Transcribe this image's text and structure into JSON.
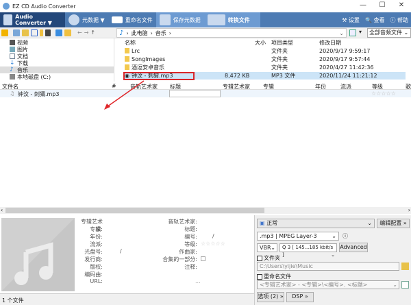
{
  "window": {
    "title": "EZ CD Audio Converter",
    "min": "—",
    "max": "☐",
    "close": "✕"
  },
  "ribbon": {
    "audio_converter": "Audio Converter ▼",
    "metadata": "元数据 ▼",
    "rename": "重命名文件",
    "save_meta": "保存元数据",
    "convert": "转换文件",
    "settings": "设置",
    "view": "查看",
    "help": "帮助"
  },
  "address": {
    "crumbs": [
      "此电脑",
      "音乐"
    ],
    "filter": "全部音频文件 ⌄"
  },
  "tree": [
    {
      "label": "视频"
    },
    {
      "label": "图片"
    },
    {
      "label": "文档"
    },
    {
      "label": "下载"
    },
    {
      "label": "音乐"
    },
    {
      "label": "本地磁盘 (C:)"
    }
  ],
  "files": {
    "headers": {
      "name": "名称",
      "size": "大小",
      "type": "项目类型",
      "date": "修改日期"
    },
    "rows": [
      {
        "name": "Lrc",
        "size": "",
        "type": "文件夹",
        "date": "2020/9/17 9:59:17"
      },
      {
        "name": "SongImages",
        "size": "",
        "type": "文件夹",
        "date": "2020/9/17 9:57:44"
      },
      {
        "name": "酒逗安卓音乐",
        "size": "",
        "type": "文件夹",
        "date": "2020/4/27 11:42:36"
      },
      {
        "name": "钟汶 - 刺猬.mp3",
        "size": "8,472 KB",
        "type": "MP3 文件",
        "date": "2020/11/24 11:21:12"
      }
    ]
  },
  "list": {
    "headers": [
      "文件名",
      "#",
      "音轨艺术家",
      "标题",
      "专辑艺术家",
      "专辑",
      "年份",
      "流派",
      "等级",
      "歌"
    ],
    "row": {
      "file": "钟汶 - 刺猬.mp3",
      "stars": "☆☆☆☆☆"
    }
  },
  "meta": {
    "left": [
      "专辑艺术家:",
      "专辑:",
      "年份:",
      "流派:",
      "光盘号:",
      "发行商:",
      "版权:",
      "编码由:",
      "URL:"
    ],
    "disc_sep": "/",
    "right": [
      "音轨艺术家:",
      "标题:",
      "编号:",
      "等级:",
      "作曲家:",
      "合集的一部分:",
      "注释:"
    ],
    "num_sep": "/",
    "stars": "☆☆☆☆☆",
    "dots": "..."
  },
  "panel": {
    "profile": "正常",
    "edit_profile": "编辑配置 »",
    "format": ".mp3 | MPEG Layer-3",
    "vbr": "VBR",
    "quality": "Q 3  [ 145...185 kbit/s ]",
    "advanced": "Advanced",
    "folder_label": "文件夹",
    "folder_path": "C:\\Users\\yijie\\Music",
    "rename_label": "重命名文件",
    "rename_pattern": "<专辑艺术家> - <专辑>\\<编号>. <标题>",
    "options": "选项 (2) »",
    "dsp": "DSP »"
  },
  "status": {
    "count": "1 个文件"
  }
}
